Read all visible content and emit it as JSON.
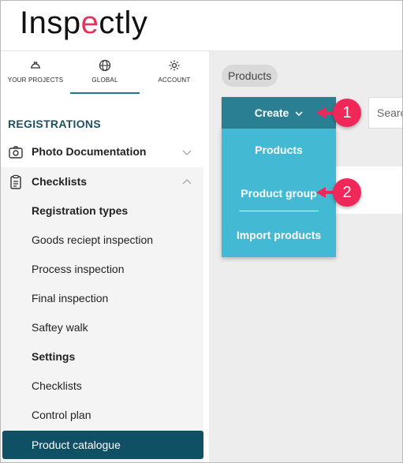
{
  "app": {
    "logo_text_a": "Insp",
    "logo_text_b": "e",
    "logo_text_c": "ctly"
  },
  "tabs": [
    {
      "label": "YOUR PROJECTS",
      "icon": "helmet-icon"
    },
    {
      "label": "GLOBAL",
      "icon": "globe-icon",
      "active": true
    },
    {
      "label": "ACCOUNT",
      "icon": "gear-icon"
    }
  ],
  "sidebar": {
    "section_title": "REGISTRATIONS",
    "photo_doc": "Photo Documentation",
    "checklists": "Checklists",
    "items": [
      {
        "label": "Registration types",
        "bold": true
      },
      {
        "label": "Goods reciept inspection"
      },
      {
        "label": "Process inspection"
      },
      {
        "label": "Final inspection"
      },
      {
        "label": "Saftey walk"
      },
      {
        "label": "Settings",
        "bold": true
      },
      {
        "label": "Checklists"
      },
      {
        "label": "Control plan"
      },
      {
        "label": "Product catalogue",
        "selected": true
      }
    ]
  },
  "main": {
    "breadcrumb": "Products",
    "create_label": "Create",
    "search_placeholder": "Search",
    "dropdown": [
      "Products",
      "Product group",
      "Import products"
    ]
  },
  "callouts": [
    "1",
    "2"
  ],
  "colors": {
    "accent": "#2a8092",
    "dropdown": "#44b9d3",
    "selected": "#0f5065",
    "callout": "#f0285a"
  }
}
